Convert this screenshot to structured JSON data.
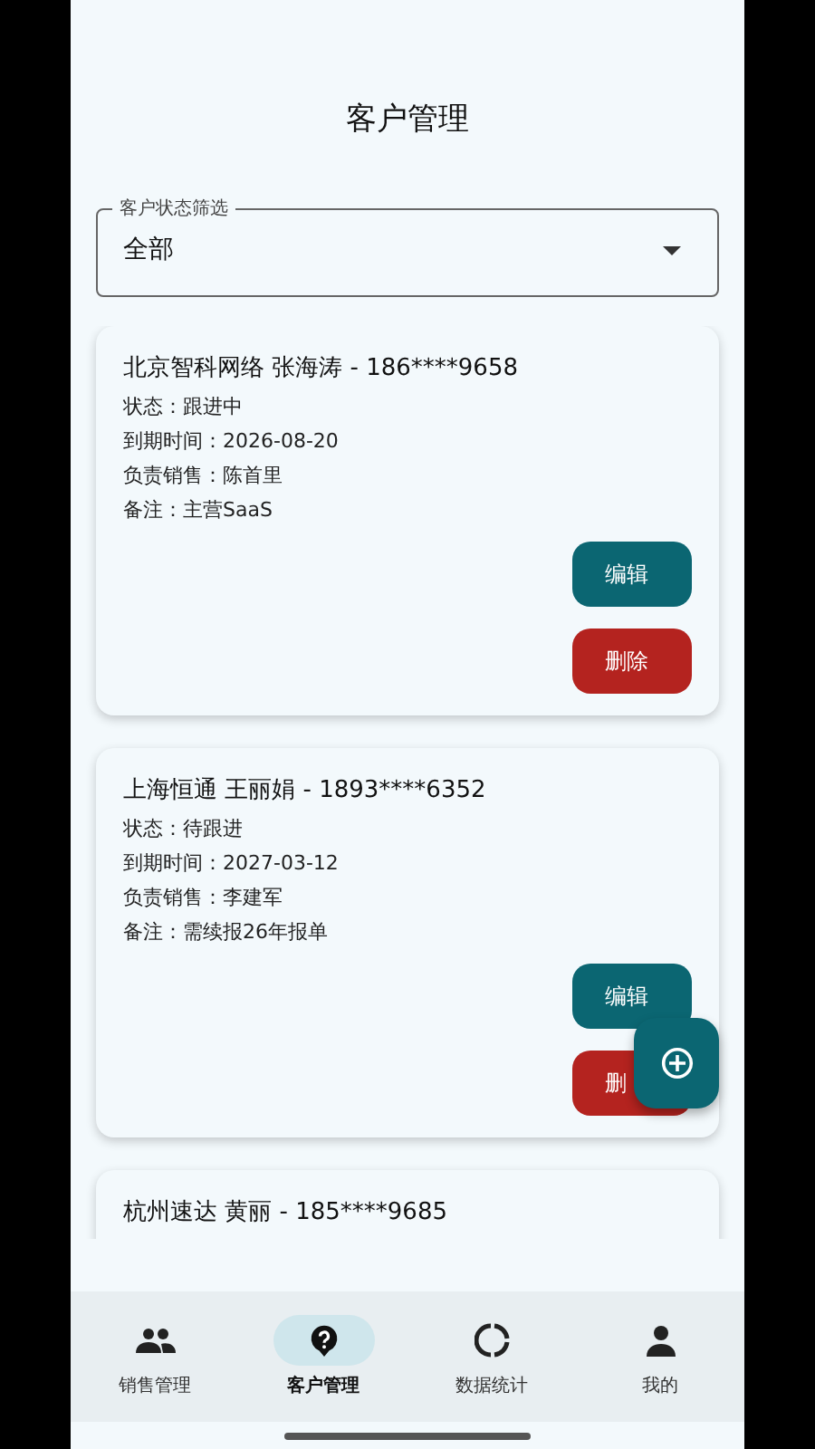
{
  "header": {
    "title": "客户管理"
  },
  "filter": {
    "label": "客户状态筛选",
    "value": "全部"
  },
  "customers": [
    {
      "title": "北京智科网络 张海涛 - 186****9658",
      "lines": [
        "状态：跟进中",
        "到期时间：2026-08-20",
        "负责销售：陈首里",
        "备注：主营SaaS"
      ],
      "buttons": [
        {
          "label": "编辑",
          "kind": "edit"
        },
        {
          "label": "删除",
          "kind": "delete"
        }
      ]
    },
    {
      "title": "上海恒通 王丽娟 - 1893****6352",
      "lines": [
        "状态：待跟进",
        "到期时间：2027-03-12",
        "负责销售：李建军",
        "备注：需续报26年报单"
      ],
      "buttons": [
        {
          "label": "编辑",
          "kind": "edit"
        },
        {
          "label": "删",
          "kind": "delete"
        }
      ]
    },
    {
      "title": "杭州速达 黄丽 - 185****9685"
    }
  ],
  "nav": [
    {
      "label": "销售管理",
      "selected": false
    },
    {
      "label": "客户管理",
      "selected": true
    },
    {
      "label": "数据统计",
      "selected": false
    },
    {
      "label": "我的",
      "selected": false
    }
  ]
}
